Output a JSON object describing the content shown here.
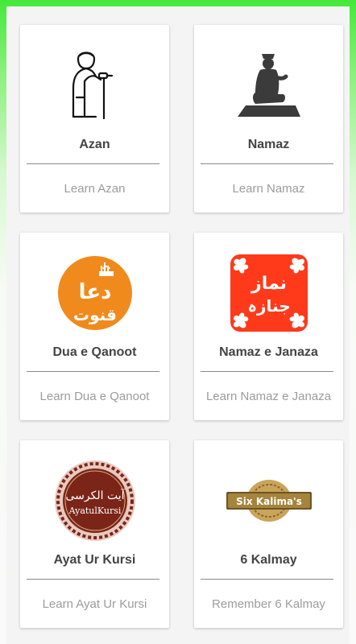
{
  "cards": [
    {
      "title": "Azan",
      "subtitle": "Learn Azan",
      "icon": "muezzin-azan-icon"
    },
    {
      "title": "Namaz",
      "subtitle": "Learn Namaz",
      "icon": "praying-man-icon"
    },
    {
      "title": "Dua e Qanoot",
      "subtitle": "Learn Dua e Qanoot",
      "icon": "dua-qanoot-badge-icon",
      "icon_text_top": "دعا",
      "icon_text_bottom": "قنوت"
    },
    {
      "title": "Namaz e Janaza",
      "subtitle": "Learn Namaz e Janaza",
      "icon": "namaz-janaza-tile-icon",
      "icon_text_top": "نماز",
      "icon_text_bottom": "جنازہ"
    },
    {
      "title": "Ayat Ur Kursi",
      "subtitle": "Learn Ayat Ur Kursi",
      "icon": "ayatul-kursi-medallion-icon",
      "icon_text_top": "آیت الکرسی",
      "icon_text_bottom": "AyatulKursi"
    },
    {
      "title": "6 Kalmay",
      "subtitle": "Remember 6 Kalmay",
      "icon": "six-kalimas-banner-icon",
      "icon_text": "Six Kalima's"
    }
  ],
  "colors": {
    "header_green": "#45e83a",
    "orange": "#f08a1d",
    "red": "#ff3a1a",
    "maroon": "#7b2418",
    "gold": "#b08a3a"
  }
}
